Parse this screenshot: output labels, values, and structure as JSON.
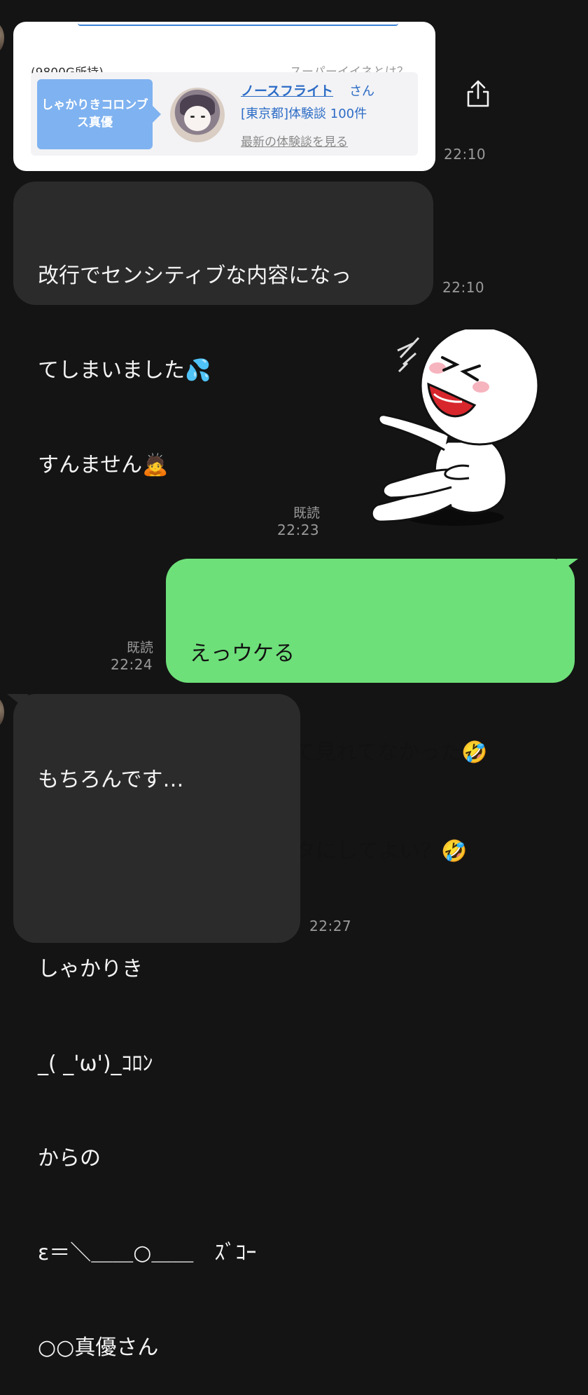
{
  "card": {
    "balance": "(9800G所持)",
    "what_is_link": "スーパーイイネとは？",
    "member_tag": "しゃかりきコロンブス真優",
    "profile_name": "ノースフライト",
    "profile_suffix": "さん",
    "profile_meta": "[東京都]体験談 100件",
    "latest_link": "最新の体験談を見る"
  },
  "messages": [
    {
      "side": "left",
      "type": "card",
      "time": "22:10"
    },
    {
      "side": "left",
      "type": "text",
      "lines": [
        "改行でセンシティブな内容になっ",
        "てしまいました💦",
        "すんません🙇"
      ],
      "time": "22:10"
    },
    {
      "side": "right",
      "type": "sticker",
      "sticker_name": "laughing-pointing-sticker",
      "read": "既読",
      "time": "22:23"
    },
    {
      "side": "right",
      "type": "text",
      "lines": [
        "えっウケる",
        "今仕事してて見れてなかった🤣",
        "ブログのネタにしてよい？🤣"
      ],
      "read": "既読",
      "time": "22:24"
    },
    {
      "side": "left",
      "type": "text",
      "lines": [
        "もちろんです…",
        "",
        "しゃかりき",
        "_( _'ω')_ｺﾛﾝ",
        "からの",
        "ε＝＼＿＿○＿＿　ｽﾞｺｰ",
        "○○真優さん"
      ],
      "time": "22:27"
    }
  ],
  "icons": {
    "share": "share-icon",
    "avatar": "avatar"
  },
  "colors": {
    "background": "#141414",
    "incoming_bubble": "#2b2b2b",
    "outgoing_bubble": "#6ee07a",
    "link_blue": "#2d6cc6",
    "tag_blue": "#7fb2f0"
  }
}
